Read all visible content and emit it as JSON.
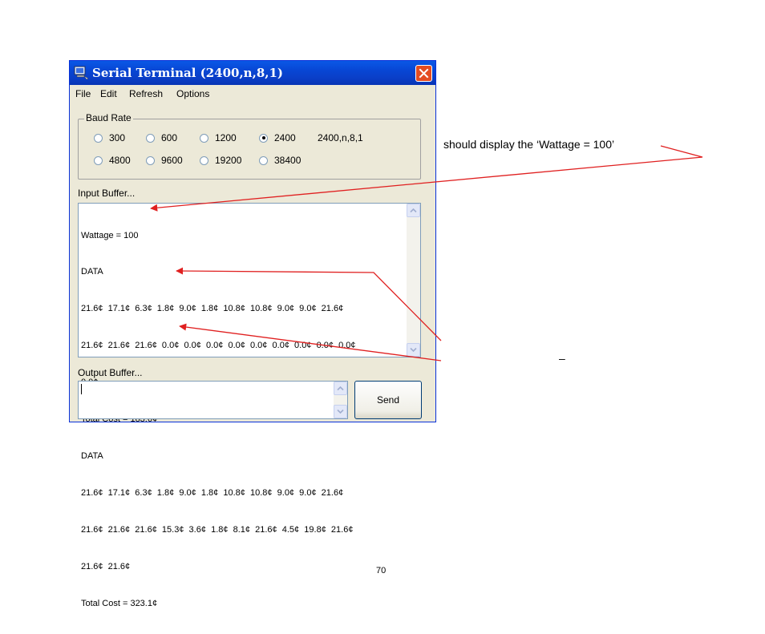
{
  "window": {
    "title": "Serial Terminal (2400,n,8,1)",
    "icon": "computer-icon",
    "close_icon": "close-icon"
  },
  "menu": {
    "items": [
      "File",
      "Edit",
      "Refresh",
      "Options"
    ]
  },
  "baud_rate": {
    "label": "Baud Rate",
    "options": [
      "300",
      "600",
      "1200",
      "2400",
      "4800",
      "9600",
      "19200",
      "38400"
    ],
    "selected": "2400",
    "settings_text": "2400,n,8,1"
  },
  "input_buffer": {
    "label": "Input Buffer...",
    "lines": [
      "Wattage = 100",
      "DATA",
      "21.6¢  17.1¢  6.3¢  1.8¢  9.0¢  1.8¢  10.8¢  10.8¢  9.0¢  9.0¢  21.6¢",
      "21.6¢  21.6¢  21.6¢  0.0¢  0.0¢  0.0¢  0.0¢  0.0¢  0.0¢  0.0¢  0.0¢  0.0¢",
      "0.0¢",
      "Total Cost = 183.6¢",
      "DATA",
      "21.6¢  17.1¢  6.3¢  1.8¢  9.0¢  1.8¢  10.8¢  10.8¢  9.0¢  9.0¢  21.6¢",
      "21.6¢  21.6¢  21.6¢  15.3¢  3.6¢  1.8¢  8.1¢  21.6¢  4.5¢  19.8¢  21.6¢",
      "21.6¢  21.6¢",
      "Total Cost = 323.1¢"
    ]
  },
  "output_buffer": {
    "label": "Output Buffer...",
    "value": ""
  },
  "send_button": {
    "label": "Send"
  },
  "annotations": {
    "wattage_note": "should display the ‘Wattage = 100’",
    "dash": "–"
  },
  "page_number": "70",
  "colors": {
    "titlebar": "#0a4fd8",
    "arrow": "#e02020",
    "close": "#e44c22"
  }
}
